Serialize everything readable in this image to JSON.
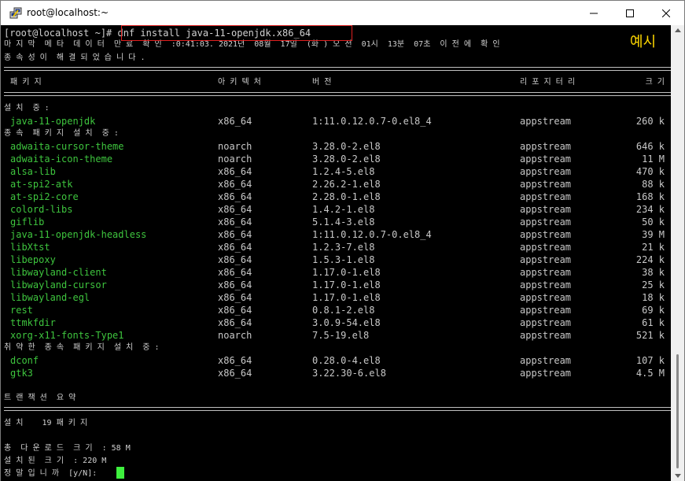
{
  "window": {
    "title": "root@localhost:~"
  },
  "annotation": {
    "example_label": "예시"
  },
  "terminal": {
    "prompt": "[root@localhost ~]# ",
    "command": "dnf install java-11-openjdk.x86_64",
    "metadata_line": "마 지 막  메 타  데 이 터  만 료  확 인  :0:41:03. 2021년  08월  17일  (화 ) 오 전  01시  13분  07초  이 전 에  확 인",
    "resolved_line": "종 속 성 이  해 결 되 었 습 니 다 .",
    "headers": {
      "package": "패 키 지",
      "arch": "아 키 텍 처",
      "version": "버 전",
      "repo": "리 포 지 터 리",
      "size": "크 기"
    },
    "install_section": "설 치  중 :",
    "install_packages": [
      {
        "name": "java-11-openjdk",
        "arch": "x86_64",
        "version": "1:11.0.12.0.7-0.el8_4",
        "repo": "appstream",
        "size": "260 k"
      }
    ],
    "dep_section": "종 속  패 키 지  설 치  중 :",
    "dep_packages": [
      {
        "name": "adwaita-cursor-theme",
        "arch": "noarch",
        "version": "3.28.0-2.el8",
        "repo": "appstream",
        "size": "646 k"
      },
      {
        "name": "adwaita-icon-theme",
        "arch": "noarch",
        "version": "3.28.0-2.el8",
        "repo": "appstream",
        "size": "11 M"
      },
      {
        "name": "alsa-lib",
        "arch": "x86_64",
        "version": "1.2.4-5.el8",
        "repo": "appstream",
        "size": "470 k"
      },
      {
        "name": "at-spi2-atk",
        "arch": "x86_64",
        "version": "2.26.2-1.el8",
        "repo": "appstream",
        "size": "88 k"
      },
      {
        "name": "at-spi2-core",
        "arch": "x86_64",
        "version": "2.28.0-1.el8",
        "repo": "appstream",
        "size": "168 k"
      },
      {
        "name": "colord-libs",
        "arch": "x86_64",
        "version": "1.4.2-1.el8",
        "repo": "appstream",
        "size": "234 k"
      },
      {
        "name": "giflib",
        "arch": "x86_64",
        "version": "5.1.4-3.el8",
        "repo": "appstream",
        "size": "50 k"
      },
      {
        "name": "java-11-openjdk-headless",
        "arch": "x86_64",
        "version": "1:11.0.12.0.7-0.el8_4",
        "repo": "appstream",
        "size": "39 M"
      },
      {
        "name": "libXtst",
        "arch": "x86_64",
        "version": "1.2.3-7.el8",
        "repo": "appstream",
        "size": "21 k"
      },
      {
        "name": "libepoxy",
        "arch": "x86_64",
        "version": "1.5.3-1.el8",
        "repo": "appstream",
        "size": "224 k"
      },
      {
        "name": "libwayland-client",
        "arch": "x86_64",
        "version": "1.17.0-1.el8",
        "repo": "appstream",
        "size": "38 k"
      },
      {
        "name": "libwayland-cursor",
        "arch": "x86_64",
        "version": "1.17.0-1.el8",
        "repo": "appstream",
        "size": "25 k"
      },
      {
        "name": "libwayland-egl",
        "arch": "x86_64",
        "version": "1.17.0-1.el8",
        "repo": "appstream",
        "size": "18 k"
      },
      {
        "name": "rest",
        "arch": "x86_64",
        "version": "0.8.1-2.el8",
        "repo": "appstream",
        "size": "69 k"
      },
      {
        "name": "ttmkfdir",
        "arch": "x86_64",
        "version": "3.0.9-54.el8",
        "repo": "appstream",
        "size": "61 k"
      },
      {
        "name": "xorg-x11-fonts-Type1",
        "arch": "noarch",
        "version": "7.5-19.el8",
        "repo": "appstream",
        "size": "521 k"
      }
    ],
    "weak_section": "취 약 한  종 속  패 키 지  설 치  중 :",
    "weak_packages": [
      {
        "name": "dconf",
        "arch": "x86_64",
        "version": "0.28.0-4.el8",
        "repo": "appstream",
        "size": "107 k"
      },
      {
        "name": "gtk3",
        "arch": "x86_64",
        "version": "3.22.30-6.el8",
        "repo": "appstream",
        "size": "4.5 M"
      }
    ],
    "summary_title": "트 랜 잭 션  요 약",
    "summary_install": "설 치    19 패 키 지",
    "download_size": "총  다 운 로 드  크 기  : 58 M",
    "installed_size": "설 치 된  크 기  : 220 M",
    "confirm_prompt": "정 말 입 니 까  [y/N]: "
  }
}
